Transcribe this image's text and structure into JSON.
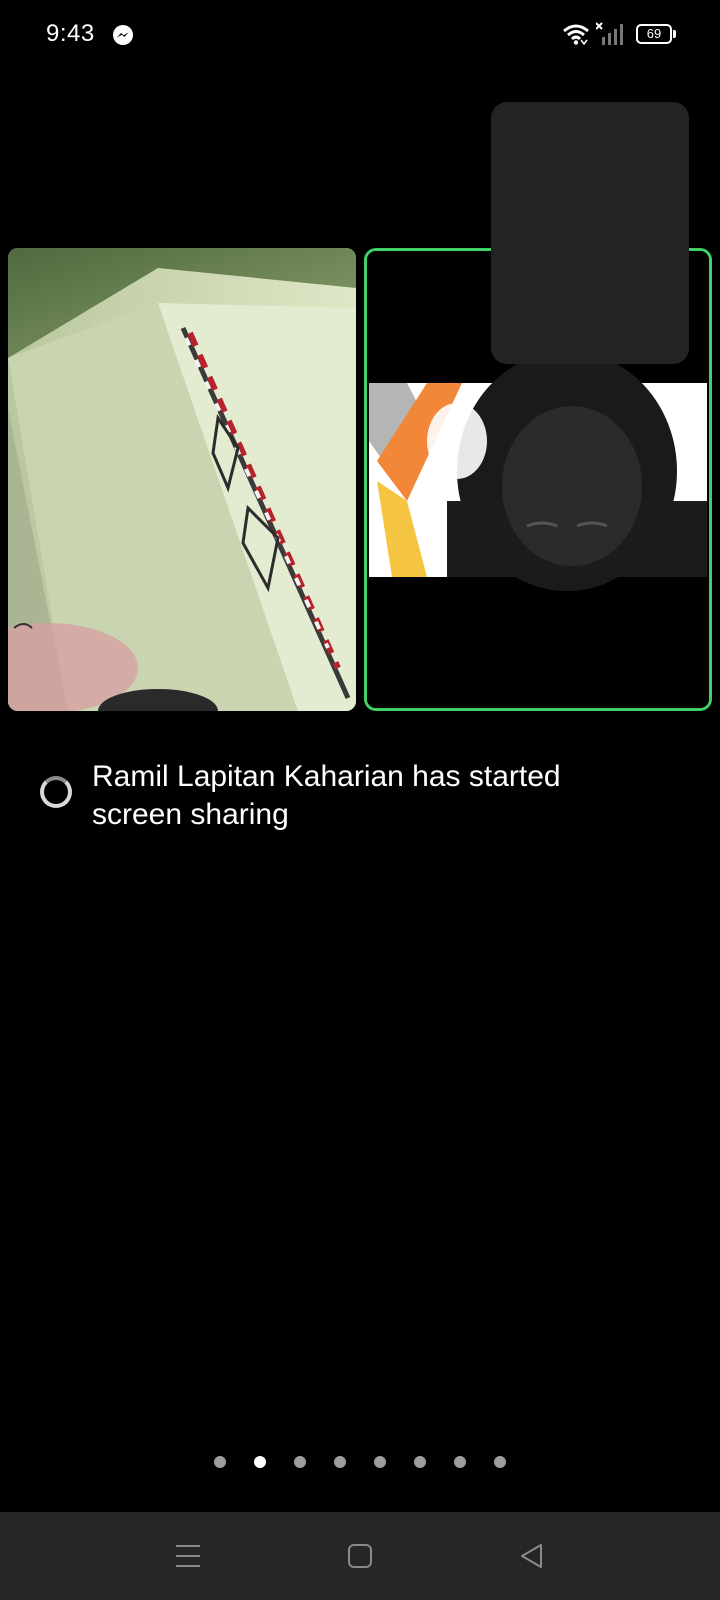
{
  "status_bar": {
    "time": "9:43",
    "battery_level": "69",
    "icons": [
      "messenger-icon",
      "wifi-icon",
      "signal-icon",
      "battery-icon"
    ]
  },
  "notification": {
    "text": "Ramil Lapitan Kaharian has started screen sharing"
  },
  "pagination": {
    "total_pages": 8,
    "active_index": 1
  },
  "nav_bar": {
    "buttons": [
      "menu",
      "home",
      "back"
    ]
  },
  "colors": {
    "active_speaker_border": "#3fd165",
    "background": "#000000",
    "self_view": "#232323",
    "nav_bar": "#262626"
  }
}
